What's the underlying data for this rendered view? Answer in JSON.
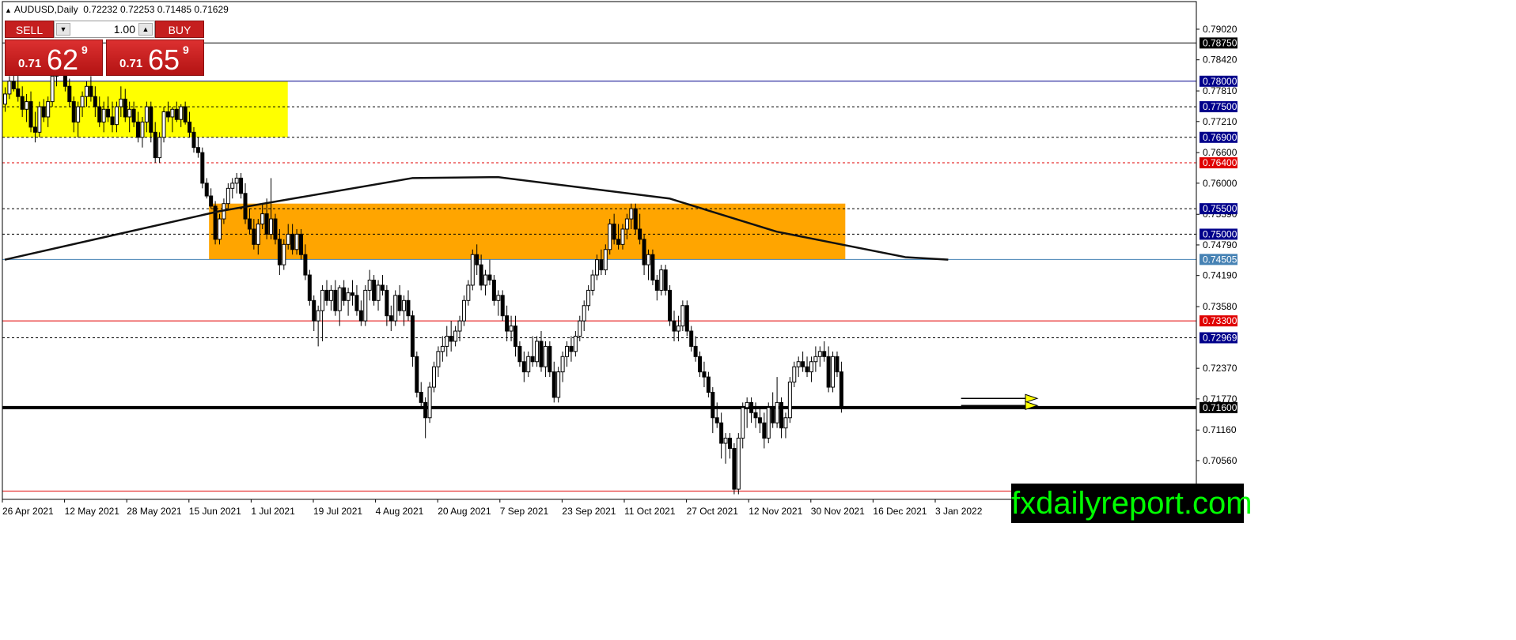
{
  "header": {
    "symbol": "AUDUSD,Daily",
    "ohlc": "0.72232 0.72253 0.71485 0.71629"
  },
  "trade_panel": {
    "sell_label": "SELL",
    "buy_label": "BUY",
    "lot": "1.00",
    "sell_price": {
      "prefix": "0.71",
      "big": "62",
      "sup": "9"
    },
    "buy_price": {
      "prefix": "0.71",
      "big": "65",
      "sup": "9"
    }
  },
  "watermark": "fxdailyreport.com",
  "colors": {
    "zone_top": "#ffff00",
    "zone_mid": "#ffa500",
    "candle_up": "#ffffff",
    "candle_down": "#000000"
  },
  "chart_data": {
    "type": "candlestick",
    "y_range": [
      0.698,
      0.795
    ],
    "y_ticks": [
      "0.79020",
      "0.78420",
      "0.77810",
      "0.77210",
      "0.76600",
      "0.76000",
      "0.75390",
      "0.74790",
      "0.74190",
      "0.73580",
      "0.72370",
      "0.71770",
      "0.71160",
      "0.70560"
    ],
    "x_ticks": [
      "26 Apr 2021",
      "12 May 2021",
      "28 May 2021",
      "15 Jun 2021",
      "1 Jul 2021",
      "19 Jul 2021",
      "4 Aug 2021",
      "20 Aug 2021",
      "7 Sep 2021",
      "23 Sep 2021",
      "11 Oct 2021",
      "27 Oct 2021",
      "12 Nov 2021",
      "30 Nov 2021",
      "16 Dec 2021",
      "3 Jan 2022"
    ],
    "levels": [
      {
        "price": 0.7875,
        "label": "0.78750",
        "style": "solid",
        "color": "#000000",
        "tag_bg": "#000000"
      },
      {
        "price": 0.78,
        "label": "0.78000",
        "style": "solid",
        "color": "#00008b",
        "tag_bg": "#00008b"
      },
      {
        "price": 0.775,
        "label": "0.77500",
        "style": "dashed",
        "color": "#000000",
        "tag_bg": "#00008b"
      },
      {
        "price": 0.769,
        "label": "0.76900",
        "style": "dashed",
        "color": "#000000",
        "tag_bg": "#00008b"
      },
      {
        "price": 0.764,
        "label": "0.76400",
        "style": "dashed",
        "color": "#e00000",
        "tag_bg": "#e00000"
      },
      {
        "price": 0.755,
        "label": "0.75500",
        "style": "dashed",
        "color": "#000000",
        "tag_bg": "#00008b"
      },
      {
        "price": 0.75,
        "label": "0.75000",
        "style": "dashed",
        "color": "#000000",
        "tag_bg": "#00008b"
      },
      {
        "price": 0.74505,
        "label": "0.74505",
        "style": "solid",
        "color": "#4682b4",
        "tag_bg": "#4682b4"
      },
      {
        "price": 0.733,
        "label": "0.73300",
        "style": "solid",
        "color": "#e00000",
        "tag_bg": "#e00000"
      },
      {
        "price": 0.72969,
        "label": "0.72969",
        "style": "dashed",
        "color": "#000000",
        "tag_bg": "#00008b"
      },
      {
        "price": 0.716,
        "label": "0.71600",
        "style": "thick",
        "color": "#000000",
        "tag_bg": "#000000"
      },
      {
        "price": 0.6996,
        "label": "",
        "style": "solid",
        "color": "#e00000",
        "tag_bg": ""
      }
    ],
    "zones": [
      {
        "name": "yellow-zone",
        "from_index": 0,
        "to_index": 66,
        "low": 0.769,
        "high": 0.78,
        "color": "#ffff00"
      },
      {
        "name": "orange-zone",
        "from_index": 48,
        "to_index": 196,
        "low": 0.74505,
        "high": 0.756,
        "color": "#ffa500"
      }
    ],
    "moving_average": [
      [
        0,
        0.745
      ],
      [
        50,
        0.7545
      ],
      [
        95,
        0.761
      ],
      [
        115,
        0.7612
      ],
      [
        155,
        0.757
      ],
      [
        180,
        0.7505
      ],
      [
        210,
        0.7455
      ],
      [
        220,
        0.745
      ]
    ],
    "arrows": [
      {
        "start_index": 223,
        "end_index": 238,
        "price": 0.7178
      },
      {
        "start_index": 223,
        "end_index": 238,
        "price": 0.7164
      }
    ],
    "candles": [
      [
        0.7755,
        0.7788,
        0.774,
        0.7775
      ],
      [
        0.7775,
        0.781,
        0.7765,
        0.78
      ],
      [
        0.78,
        0.7825,
        0.778,
        0.7785
      ],
      [
        0.7785,
        0.7815,
        0.776,
        0.777
      ],
      [
        0.777,
        0.779,
        0.773,
        0.7745
      ],
      [
        0.7745,
        0.7775,
        0.772,
        0.776
      ],
      [
        0.776,
        0.778,
        0.77,
        0.771
      ],
      [
        0.771,
        0.774,
        0.768,
        0.77
      ],
      [
        0.77,
        0.776,
        0.769,
        0.775
      ],
      [
        0.775,
        0.7765,
        0.772,
        0.773
      ],
      [
        0.773,
        0.777,
        0.771,
        0.776
      ],
      [
        0.776,
        0.782,
        0.775,
        0.781
      ],
      [
        0.781,
        0.785,
        0.779,
        0.784
      ],
      [
        0.784,
        0.786,
        0.782,
        0.783
      ],
      [
        0.783,
        0.784,
        0.778,
        0.779
      ],
      [
        0.779,
        0.7805,
        0.775,
        0.776
      ],
      [
        0.776,
        0.777,
        0.77,
        0.772
      ],
      [
        0.772,
        0.776,
        0.769,
        0.775
      ],
      [
        0.775,
        0.778,
        0.773,
        0.777
      ],
      [
        0.777,
        0.78,
        0.775,
        0.779
      ],
      [
        0.779,
        0.781,
        0.776,
        0.777
      ],
      [
        0.777,
        0.779,
        0.773,
        0.775
      ],
      [
        0.775,
        0.777,
        0.771,
        0.772
      ],
      [
        0.772,
        0.776,
        0.77,
        0.7745
      ],
      [
        0.7745,
        0.777,
        0.772,
        0.773
      ],
      [
        0.773,
        0.776,
        0.77,
        0.7715
      ],
      [
        0.7715,
        0.776,
        0.77,
        0.775
      ],
      [
        0.775,
        0.779,
        0.773,
        0.7765
      ],
      [
        0.7765,
        0.7785,
        0.772,
        0.773
      ],
      [
        0.773,
        0.776,
        0.77,
        0.7745
      ],
      [
        0.7745,
        0.776,
        0.771,
        0.772
      ],
      [
        0.772,
        0.774,
        0.768,
        0.769
      ],
      [
        0.769,
        0.773,
        0.767,
        0.772
      ],
      [
        0.772,
        0.776,
        0.77,
        0.775
      ],
      [
        0.775,
        0.776,
        0.768,
        0.77
      ],
      [
        0.77,
        0.772,
        0.764,
        0.765
      ],
      [
        0.765,
        0.77,
        0.764,
        0.769
      ],
      [
        0.769,
        0.775,
        0.768,
        0.774
      ],
      [
        0.774,
        0.776,
        0.772,
        0.773
      ],
      [
        0.773,
        0.775,
        0.77,
        0.7745
      ],
      [
        0.7745,
        0.776,
        0.772,
        0.7725
      ],
      [
        0.7725,
        0.7755,
        0.771,
        0.775
      ],
      [
        0.775,
        0.776,
        0.7715,
        0.772
      ],
      [
        0.772,
        0.774,
        0.769,
        0.77
      ],
      [
        0.77,
        0.771,
        0.766,
        0.767
      ],
      [
        0.767,
        0.769,
        0.765,
        0.766
      ],
      [
        0.766,
        0.767,
        0.759,
        0.76
      ],
      [
        0.76,
        0.761,
        0.757,
        0.7575
      ],
      [
        0.7575,
        0.759,
        0.755,
        0.7555
      ],
      [
        0.7555,
        0.7565,
        0.748,
        0.749
      ],
      [
        0.749,
        0.754,
        0.748,
        0.753
      ],
      [
        0.753,
        0.757,
        0.752,
        0.756
      ],
      [
        0.756,
        0.76,
        0.755,
        0.759
      ],
      [
        0.759,
        0.761,
        0.757,
        0.76
      ],
      [
        0.76,
        0.762,
        0.758,
        0.761
      ],
      [
        0.761,
        0.762,
        0.757,
        0.758
      ],
      [
        0.758,
        0.76,
        0.752,
        0.753
      ],
      [
        0.753,
        0.755,
        0.75,
        0.751
      ],
      [
        0.751,
        0.753,
        0.747,
        0.748
      ],
      [
        0.748,
        0.753,
        0.746,
        0.752
      ],
      [
        0.752,
        0.756,
        0.751,
        0.754
      ],
      [
        0.754,
        0.757,
        0.749,
        0.75
      ],
      [
        0.75,
        0.761,
        0.749,
        0.753
      ],
      [
        0.753,
        0.754,
        0.748,
        0.749
      ],
      [
        0.749,
        0.751,
        0.742,
        0.744
      ],
      [
        0.744,
        0.749,
        0.743,
        0.748
      ],
      [
        0.748,
        0.752,
        0.747,
        0.75
      ],
      [
        0.75,
        0.752,
        0.746,
        0.747
      ],
      [
        0.747,
        0.751,
        0.746,
        0.75
      ],
      [
        0.75,
        0.751,
        0.745,
        0.746
      ],
      [
        0.746,
        0.748,
        0.741,
        0.742
      ],
      [
        0.742,
        0.743,
        0.736,
        0.737
      ],
      [
        0.737,
        0.738,
        0.731,
        0.733
      ],
      [
        0.733,
        0.736,
        0.728,
        0.735
      ],
      [
        0.735,
        0.74,
        0.729,
        0.739
      ],
      [
        0.739,
        0.741,
        0.736,
        0.737
      ],
      [
        0.737,
        0.74,
        0.735,
        0.739
      ],
      [
        0.739,
        0.741,
        0.734,
        0.735
      ],
      [
        0.735,
        0.74,
        0.732,
        0.7395
      ],
      [
        0.7395,
        0.741,
        0.736,
        0.737
      ],
      [
        0.737,
        0.7395,
        0.734,
        0.7385
      ],
      [
        0.7385,
        0.741,
        0.736,
        0.738
      ],
      [
        0.738,
        0.74,
        0.734,
        0.735
      ],
      [
        0.735,
        0.737,
        0.732,
        0.733
      ],
      [
        0.733,
        0.74,
        0.732,
        0.739
      ],
      [
        0.739,
        0.743,
        0.737,
        0.741
      ],
      [
        0.741,
        0.742,
        0.736,
        0.737
      ],
      [
        0.737,
        0.741,
        0.735,
        0.74
      ],
      [
        0.74,
        0.742,
        0.738,
        0.739
      ],
      [
        0.739,
        0.74,
        0.732,
        0.734
      ],
      [
        0.734,
        0.736,
        0.731,
        0.733
      ],
      [
        0.733,
        0.739,
        0.732,
        0.738
      ],
      [
        0.738,
        0.74,
        0.734,
        0.735
      ],
      [
        0.735,
        0.738,
        0.732,
        0.737
      ],
      [
        0.737,
        0.739,
        0.733,
        0.734
      ],
      [
        0.734,
        0.735,
        0.724,
        0.726
      ],
      [
        0.726,
        0.727,
        0.718,
        0.719
      ],
      [
        0.719,
        0.721,
        0.716,
        0.717
      ],
      [
        0.717,
        0.718,
        0.71,
        0.714
      ],
      [
        0.714,
        0.721,
        0.713,
        0.72
      ],
      [
        0.72,
        0.725,
        0.719,
        0.724
      ],
      [
        0.724,
        0.728,
        0.722,
        0.727
      ],
      [
        0.727,
        0.73,
        0.725,
        0.728
      ],
      [
        0.728,
        0.732,
        0.726,
        0.73
      ],
      [
        0.73,
        0.733,
        0.727,
        0.729
      ],
      [
        0.729,
        0.732,
        0.728,
        0.731
      ],
      [
        0.731,
        0.734,
        0.729,
        0.733
      ],
      [
        0.733,
        0.738,
        0.732,
        0.737
      ],
      [
        0.737,
        0.741,
        0.736,
        0.74
      ],
      [
        0.74,
        0.747,
        0.739,
        0.746
      ],
      [
        0.746,
        0.748,
        0.742,
        0.744
      ],
      [
        0.744,
        0.746,
        0.739,
        0.74
      ],
      [
        0.74,
        0.743,
        0.738,
        0.742
      ],
      [
        0.742,
        0.745,
        0.74,
        0.741
      ],
      [
        0.741,
        0.742,
        0.736,
        0.737
      ],
      [
        0.737,
        0.739,
        0.734,
        0.738
      ],
      [
        0.738,
        0.739,
        0.733,
        0.734
      ],
      [
        0.734,
        0.736,
        0.729,
        0.731
      ],
      [
        0.731,
        0.734,
        0.729,
        0.732
      ],
      [
        0.732,
        0.734,
        0.726,
        0.728
      ],
      [
        0.728,
        0.729,
        0.724,
        0.725
      ],
      [
        0.725,
        0.727,
        0.721,
        0.723
      ],
      [
        0.723,
        0.727,
        0.722,
        0.726
      ],
      [
        0.726,
        0.73,
        0.724,
        0.725
      ],
      [
        0.725,
        0.73,
        0.724,
        0.729
      ],
      [
        0.729,
        0.731,
        0.723,
        0.724
      ],
      [
        0.724,
        0.729,
        0.722,
        0.728
      ],
      [
        0.728,
        0.729,
        0.722,
        0.723
      ],
      [
        0.723,
        0.725,
        0.717,
        0.718
      ],
      [
        0.718,
        0.724,
        0.717,
        0.723
      ],
      [
        0.723,
        0.727,
        0.721,
        0.726
      ],
      [
        0.726,
        0.729,
        0.724,
        0.728
      ],
      [
        0.728,
        0.73,
        0.725,
        0.727
      ],
      [
        0.727,
        0.731,
        0.726,
        0.73
      ],
      [
        0.73,
        0.734,
        0.729,
        0.733
      ],
      [
        0.733,
        0.737,
        0.731,
        0.736
      ],
      [
        0.736,
        0.74,
        0.735,
        0.739
      ],
      [
        0.739,
        0.743,
        0.738,
        0.742
      ],
      [
        0.742,
        0.746,
        0.741,
        0.745
      ],
      [
        0.745,
        0.747,
        0.742,
        0.743
      ],
      [
        0.743,
        0.748,
        0.742,
        0.747
      ],
      [
        0.747,
        0.753,
        0.746,
        0.752
      ],
      [
        0.752,
        0.754,
        0.748,
        0.749
      ],
      [
        0.749,
        0.752,
        0.747,
        0.748
      ],
      [
        0.748,
        0.752,
        0.747,
        0.751
      ],
      [
        0.751,
        0.754,
        0.749,
        0.753
      ],
      [
        0.753,
        0.756,
        0.751,
        0.755
      ],
      [
        0.755,
        0.756,
        0.75,
        0.751
      ],
      [
        0.751,
        0.754,
        0.748,
        0.749
      ],
      [
        0.749,
        0.75,
        0.742,
        0.744
      ],
      [
        0.744,
        0.747,
        0.741,
        0.746
      ],
      [
        0.746,
        0.747,
        0.74,
        0.741
      ],
      [
        0.741,
        0.742,
        0.737,
        0.739
      ],
      [
        0.739,
        0.744,
        0.738,
        0.743
      ],
      [
        0.743,
        0.744,
        0.738,
        0.739
      ],
      [
        0.739,
        0.74,
        0.732,
        0.733
      ],
      [
        0.733,
        0.735,
        0.729,
        0.731
      ],
      [
        0.731,
        0.734,
        0.729,
        0.732
      ],
      [
        0.732,
        0.737,
        0.731,
        0.736
      ],
      [
        0.736,
        0.737,
        0.73,
        0.731
      ],
      [
        0.731,
        0.732,
        0.727,
        0.728
      ],
      [
        0.728,
        0.73,
        0.725,
        0.726
      ],
      [
        0.726,
        0.727,
        0.722,
        0.723
      ],
      [
        0.723,
        0.725,
        0.72,
        0.722
      ],
      [
        0.722,
        0.723,
        0.718,
        0.719
      ],
      [
        0.719,
        0.72,
        0.711,
        0.714
      ],
      [
        0.714,
        0.717,
        0.712,
        0.713
      ],
      [
        0.713,
        0.715,
        0.706,
        0.709
      ],
      [
        0.709,
        0.711,
        0.705,
        0.71
      ],
      [
        0.71,
        0.711,
        0.706,
        0.708
      ],
      [
        0.708,
        0.709,
        0.699,
        0.7
      ],
      [
        0.7,
        0.711,
        0.699,
        0.71
      ],
      [
        0.71,
        0.717,
        0.708,
        0.716
      ],
      [
        0.716,
        0.718,
        0.712,
        0.717
      ],
      [
        0.717,
        0.718,
        0.713,
        0.715
      ],
      [
        0.715,
        0.717,
        0.712,
        0.714
      ],
      [
        0.714,
        0.716,
        0.711,
        0.713
      ],
      [
        0.713,
        0.715,
        0.708,
        0.71
      ],
      [
        0.71,
        0.717,
        0.709,
        0.716
      ],
      [
        0.716,
        0.719,
        0.712,
        0.713
      ],
      [
        0.713,
        0.722,
        0.712,
        0.717
      ],
      [
        0.717,
        0.718,
        0.71,
        0.712
      ],
      [
        0.712,
        0.715,
        0.71,
        0.714
      ],
      [
        0.714,
        0.722,
        0.713,
        0.721
      ],
      [
        0.721,
        0.725,
        0.72,
        0.724
      ],
      [
        0.724,
        0.726,
        0.722,
        0.725
      ],
      [
        0.725,
        0.727,
        0.723,
        0.724
      ],
      [
        0.724,
        0.726,
        0.722,
        0.723
      ],
      [
        0.723,
        0.726,
        0.721,
        0.725
      ],
      [
        0.725,
        0.728,
        0.723,
        0.726
      ],
      [
        0.726,
        0.728,
        0.724,
        0.727
      ],
      [
        0.727,
        0.729,
        0.725,
        0.726
      ],
      [
        0.726,
        0.728,
        0.719,
        0.72
      ],
      [
        0.72,
        0.727,
        0.719,
        0.726
      ],
      [
        0.726,
        0.727,
        0.722,
        0.723
      ],
      [
        0.723,
        0.725,
        0.715,
        0.7163
      ]
    ]
  }
}
